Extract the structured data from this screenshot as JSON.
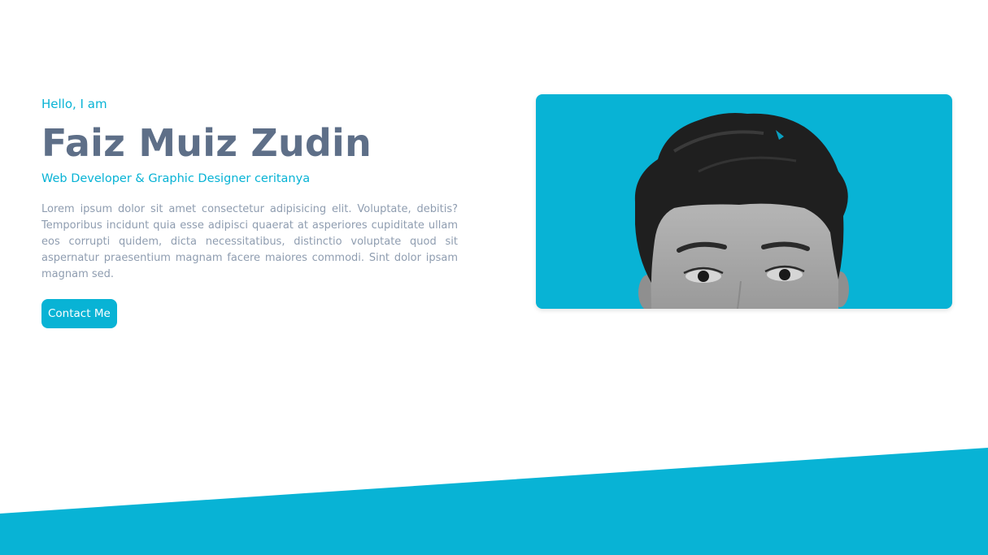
{
  "hero": {
    "greeting": "Hello, I am",
    "name": "Faiz Muiz Zudin",
    "role": "Web Developer & Graphic Designer ceritanya",
    "bio": "Lorem ipsum dolor sit amet consectetur adipisicing elit. Voluptate, debitis? Temporibus incidunt quia esse adipisci quaerat at asperiores cupiditate ullam eos corrupti quidem, dicta necessitatibus, distinctio voluptate quod sit aspernatur praesentium magnam facere maiores commodi. Sint dolor ipsam magnam sed.",
    "contact_button_label": "Contact Me"
  },
  "photo": {
    "subject": "profile-photo",
    "background_color": "#08b3d5"
  },
  "colors": {
    "accent": "#08b3d5",
    "name_text": "#5e6f88",
    "body_text": "#8f9db0",
    "background": "#ffffff"
  }
}
